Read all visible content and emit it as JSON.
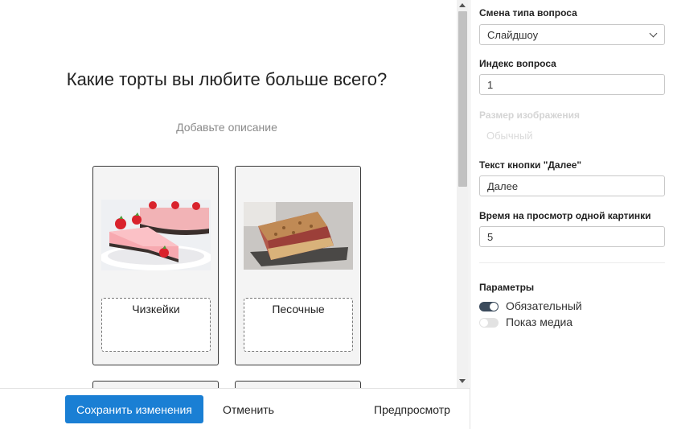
{
  "question": {
    "title": "Какие торты вы любите больше всего?",
    "description": "Добавьте описание"
  },
  "cards": [
    {
      "label": "Чизкейки",
      "image": "cheesecake-photo"
    },
    {
      "label": "Песочные",
      "image": "shortbread-cake-photo"
    }
  ],
  "toolbar": {
    "save_label": "Сохранить изменения",
    "cancel_label": "Отменить",
    "preview_label": "Предпросмотр"
  },
  "settings": {
    "type_label": "Смена типа вопроса",
    "type_value": "Слайдшоу",
    "index_label": "Индекс вопроса",
    "index_value": "1",
    "image_size_label": "Размер изображения",
    "image_size_value": "Обычный",
    "next_button_label": "Текст кнопки \"Далее\"",
    "next_button_value": "Далее",
    "view_time_label": "Время на просмотр одной картинки",
    "view_time_value": "5",
    "params_label": "Параметры",
    "required_label": "Обязательный",
    "required_on": true,
    "show_media_label": "Показ медиа",
    "show_media_on": false
  },
  "colors": {
    "accent": "#1a7fd4",
    "toggle_on": "#3b4b5c"
  }
}
